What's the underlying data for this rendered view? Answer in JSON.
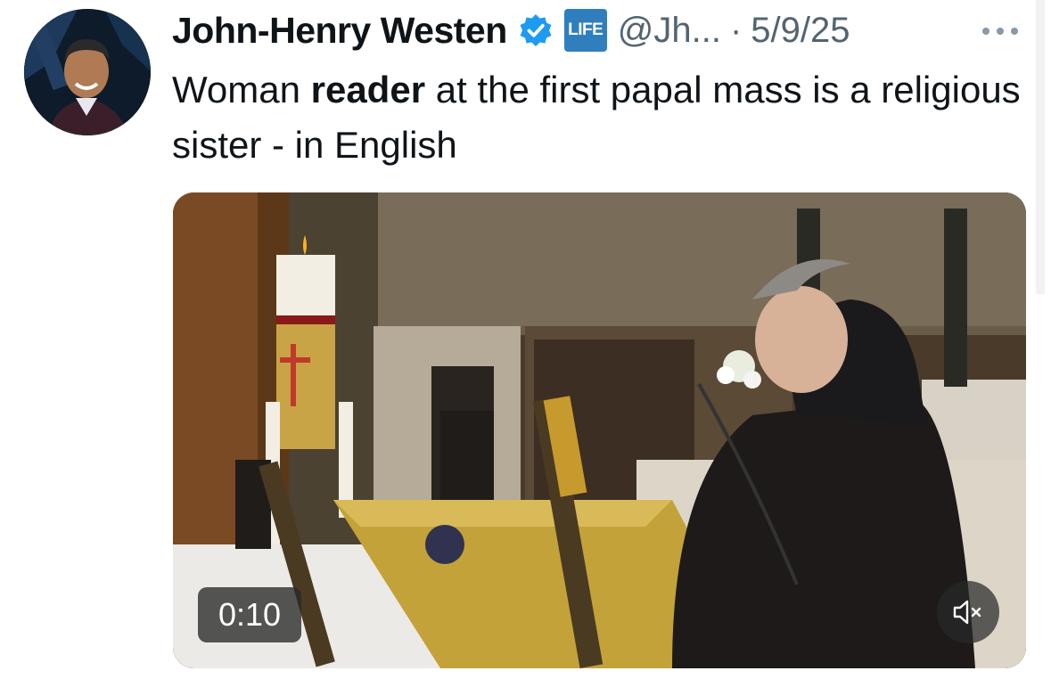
{
  "author": {
    "name": "John-Henry Westen",
    "verified_icon": "verified-badge-icon",
    "affiliate_badge": "LIFE",
    "handle": "@Jh...",
    "separator": "·",
    "date": "5/9/25"
  },
  "more_icon": "more-icon",
  "tweet": {
    "text_before": "Woman ",
    "text_bold": "reader",
    "text_after": " at the first papal mass is a religious sister - in English"
  },
  "video": {
    "duration": "0:10",
    "mute_icon": "muted-speaker-icon"
  },
  "colors": {
    "accent_blue": "#1d9bf0",
    "affiliate_badge_bg": "#2f7fbe",
    "secondary_text": "#536471"
  }
}
